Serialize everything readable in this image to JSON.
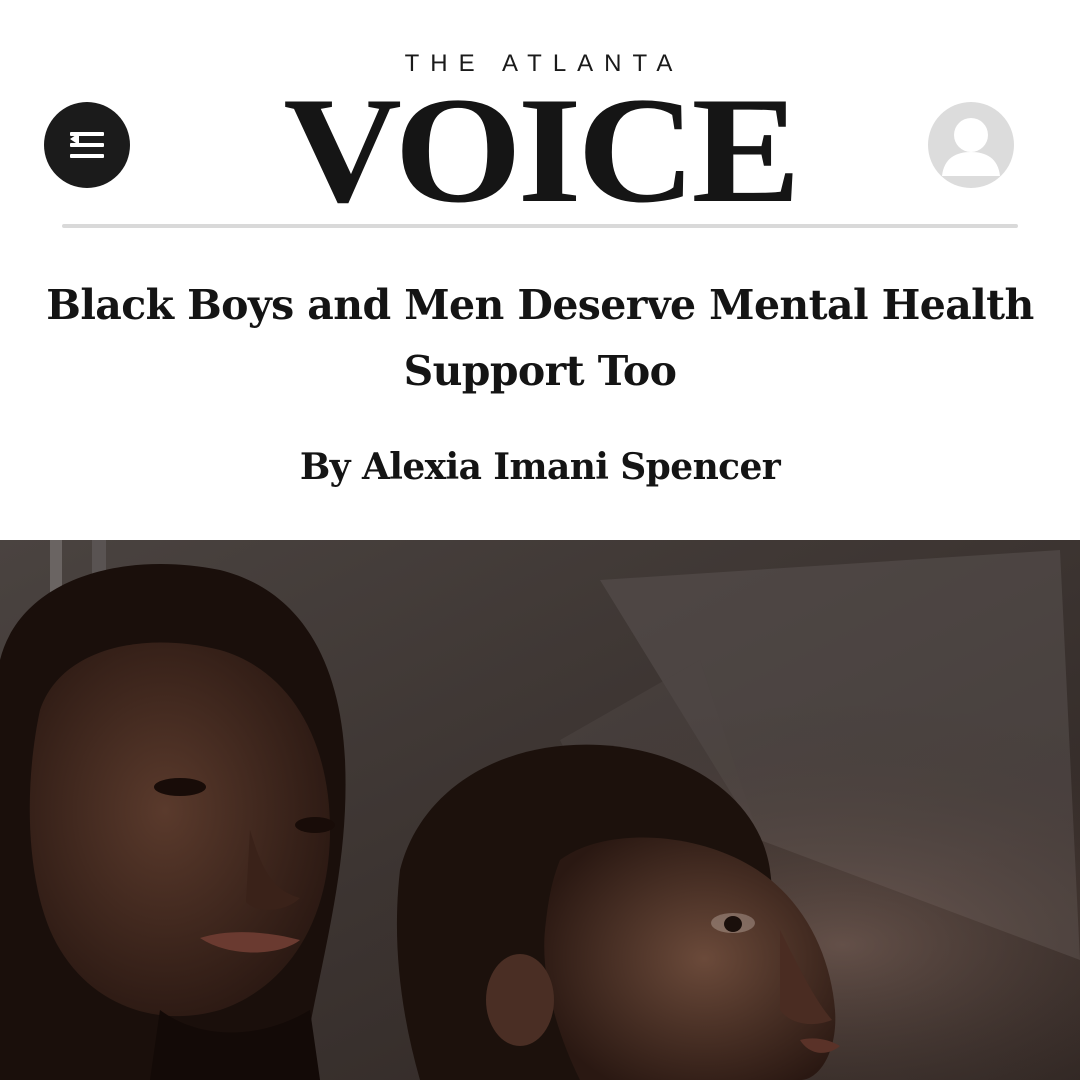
{
  "header": {
    "brand_kicker": "THE ATLANTA",
    "brand_name": "VOICE",
    "menu_icon": "menu-icon",
    "account_icon": "user-icon"
  },
  "article": {
    "headline": "Black Boys and Men Deserve Mental Health Support Too",
    "byline": "By Alexia Imani Spencer"
  },
  "colors": {
    "background": "#ffffff",
    "text": "#141414",
    "menu_button": "#1b1b1b",
    "account_button": "#dcdcdc",
    "rule": "#d9d9d9"
  }
}
